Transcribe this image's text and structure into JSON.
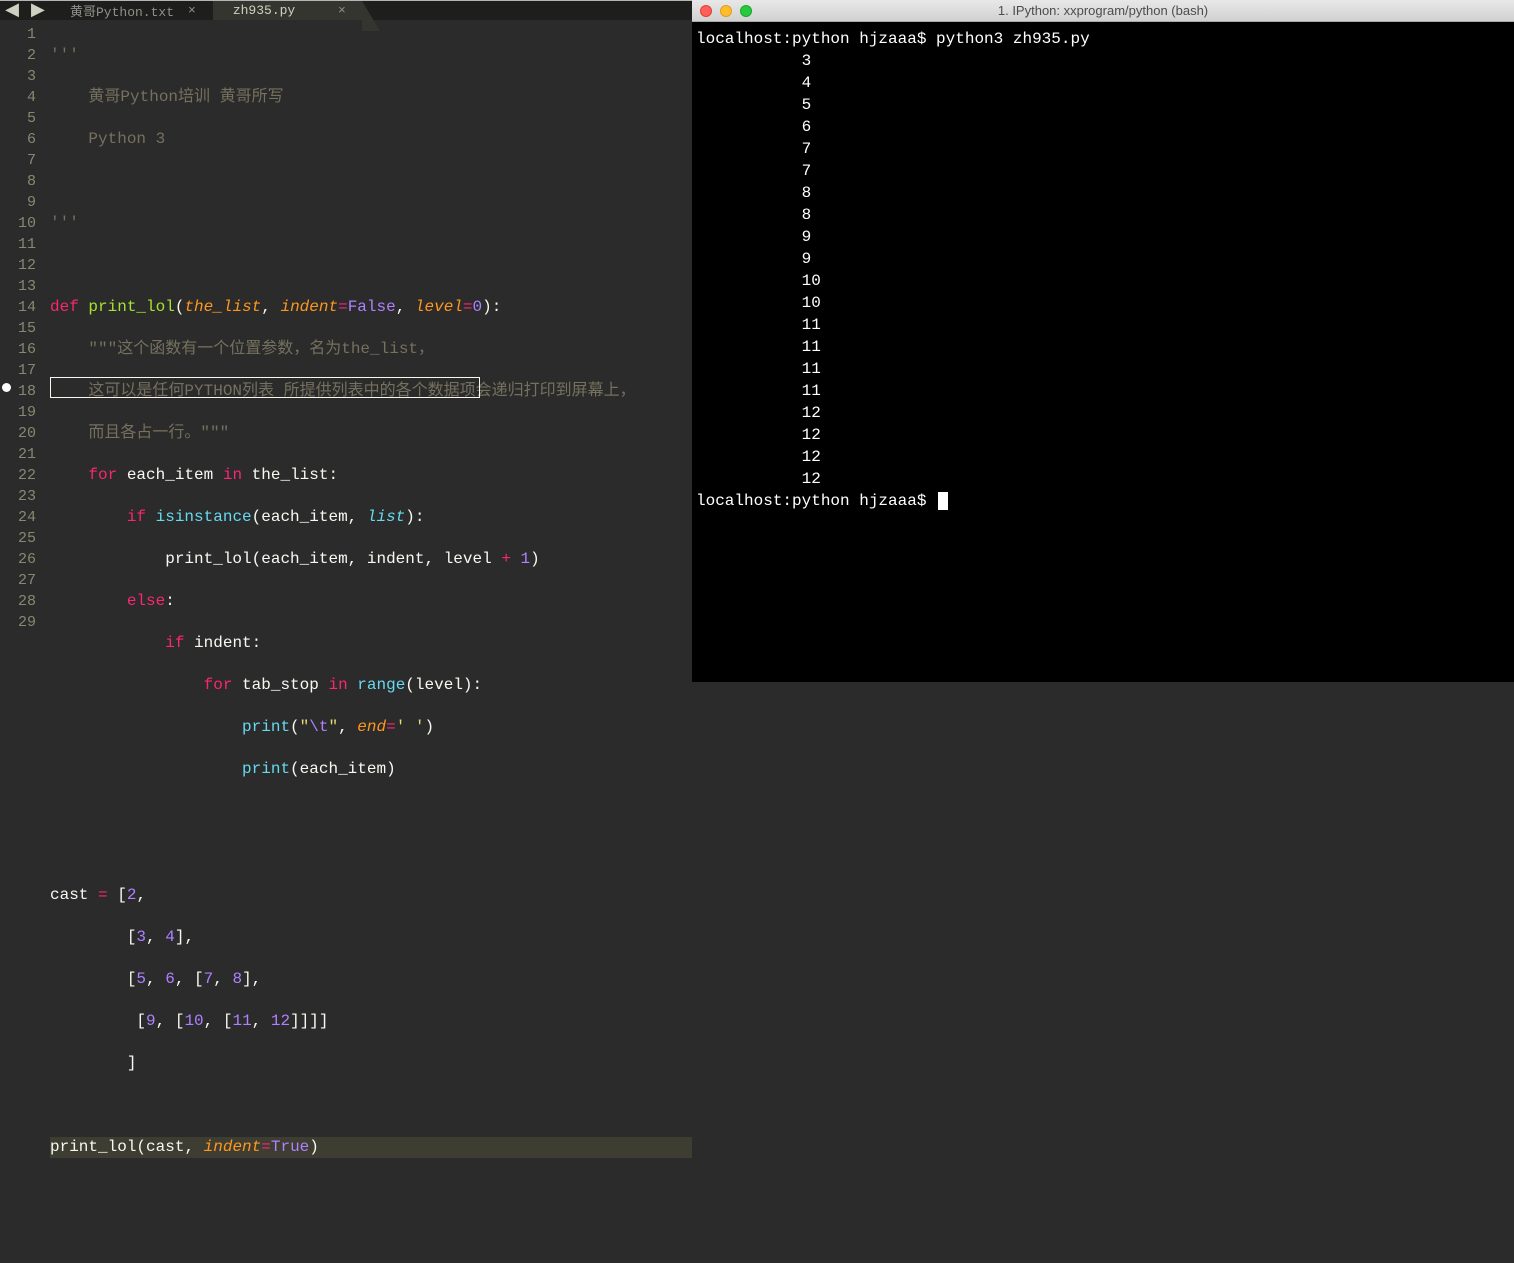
{
  "editor": {
    "tabs": [
      {
        "label": "黄哥Python.txt",
        "active": false
      },
      {
        "label": "zh935.py",
        "active": true
      }
    ],
    "nav": {
      "prev": "◀",
      "next": "▶"
    },
    "line_count": 29,
    "breakpoint_line": 18,
    "selected_line": 18,
    "full_line_bg": 28,
    "tokens": {
      "l1": "'''",
      "l2_a": "黄哥Python培训 黄哥所写",
      "l3_a": "Python 3",
      "l5": "'''",
      "l7_def": "def",
      "l7_fn": "print_lol",
      "l7_p1": "the_list",
      "l7_p2": "indent",
      "l7_v2": "False",
      "l7_p3": "level",
      "l7_v3": "0",
      "l8_doc": "\"\"\"这个函数有一个位置参数，名为the_list，",
      "l9_doc": "这可以是任何PYTHON列表 所提供列表中的各个数据项会递归打印到屏幕上，",
      "l10_doc": "而且各占一行。\"\"\"",
      "l11_for": "for",
      "l11_var": "each_item",
      "l11_in": "in",
      "l11_iter": "the_list",
      "l12_if": "if",
      "l12_call": "isinstance",
      "l12_a1": "each_item",
      "l12_a2": "list",
      "l13_call": "print_lol",
      "l13_a1": "each_item",
      "l13_a2": "indent",
      "l13_a3": "level",
      "l13_plus": "+",
      "l13_one": "1",
      "l14_else": "else",
      "l15_if": "if",
      "l15_var": "indent",
      "l16_for": "for",
      "l16_var": "tab_stop",
      "l16_in": "in",
      "l16_call": "range",
      "l16_arg": "level",
      "l17_call": "print",
      "l17_str_open": "\"",
      "l17_str_esc": "\\t",
      "l17_str_close": "\"",
      "l17_kw": "end",
      "l17_val": "' '",
      "l18_call": "print",
      "l18_arg": "each_item",
      "l22_var": "cast",
      "l22_eq": "=",
      "l22_n1": "2",
      "l23_n1": "3",
      "l23_n2": "4",
      "l24_n1": "5",
      "l24_n2": "6",
      "l24_n3": "7",
      "l24_n4": "8",
      "l25_n1": "9",
      "l25_n2": "10",
      "l25_n3": "11",
      "l25_n4": "12",
      "l28_call": "print_lol",
      "l28_a1": "cast",
      "l28_kw": "indent",
      "l28_val": "True"
    }
  },
  "terminal": {
    "title": "1. IPython: xxprogram/python (bash)",
    "prompt1": "localhost:python hjzaaa$ ",
    "cmd": "python3 zh935.py",
    "output": [
      "3",
      "4",
      "5",
      "6",
      "7",
      "7",
      "8",
      "8",
      "9",
      "9",
      "10",
      "10",
      "11",
      "11",
      "11",
      "11",
      "12",
      "12",
      "12",
      "12"
    ],
    "prompt2": "localhost:python hjzaaa$ "
  }
}
